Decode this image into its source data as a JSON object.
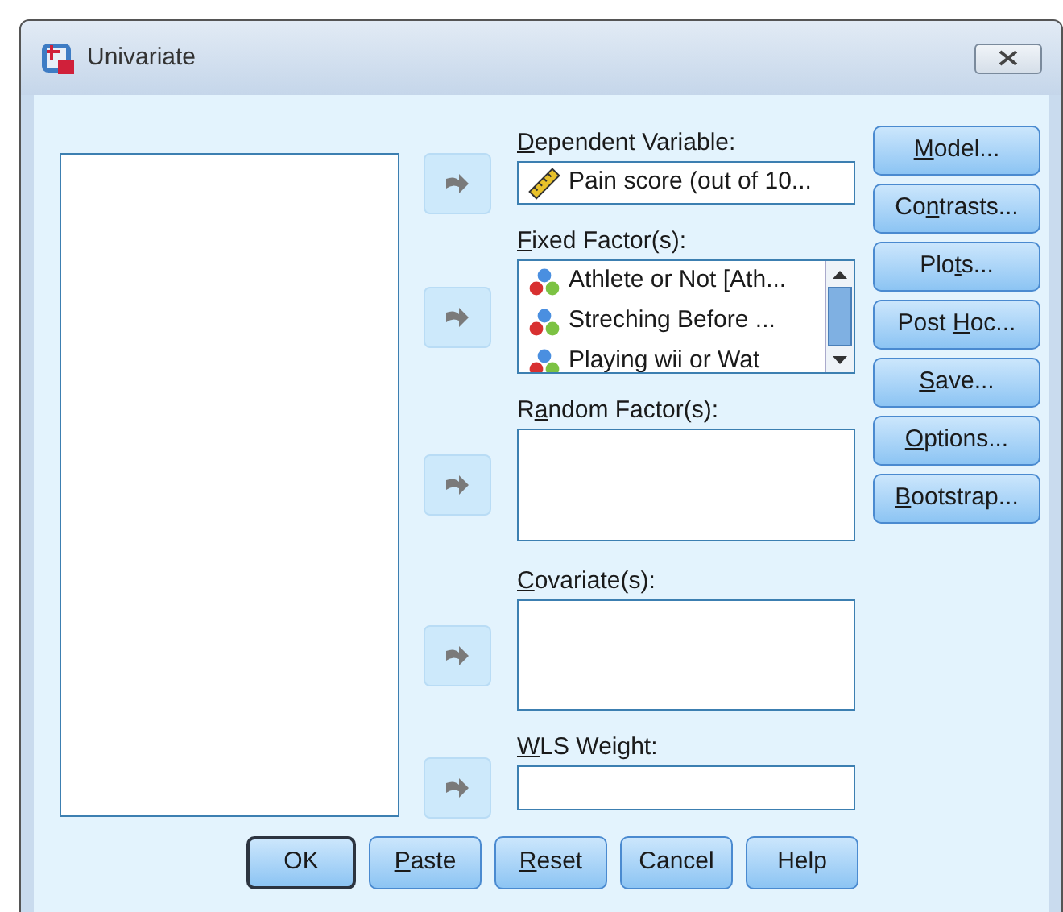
{
  "window": {
    "title": "Univariate"
  },
  "targets": [
    {
      "kind": "single",
      "label": {
        "key": "D",
        "post": "ependent Variable:"
      },
      "items": [
        {
          "kind": "scale",
          "text": "Pain score (out of 10..."
        }
      ]
    },
    {
      "kind": "list",
      "label": {
        "key": "F",
        "post": "ixed Factor(s):"
      },
      "items": [
        {
          "kind": "nominal",
          "text": "Athlete or Not [Ath..."
        },
        {
          "kind": "nominal",
          "text": "Streching Before ..."
        },
        {
          "kind": "nominal",
          "text": "Playing wii or Wat"
        }
      ]
    },
    {
      "kind": "list",
      "label": {
        "pre": "R",
        "key": "a",
        "post": "ndom Factor(s):"
      }
    },
    {
      "kind": "list",
      "label": {
        "key": "C",
        "post": "ovariate(s):"
      }
    },
    {
      "kind": "single",
      "label": {
        "key": "W",
        "post": "LS Weight:"
      }
    }
  ],
  "side_buttons": [
    {
      "key": "M",
      "post": "odel..."
    },
    {
      "pre": "Co",
      "key": "n",
      "post": "trasts..."
    },
    {
      "pre": "Plo",
      "key": "t",
      "post": "s..."
    },
    {
      "pre": "Post ",
      "key": "H",
      "post": "oc..."
    },
    {
      "key": "S",
      "post": "ave..."
    },
    {
      "key": "O",
      "post": "ptions..."
    },
    {
      "key": "B",
      "post": "ootstrap..."
    }
  ],
  "bottom_buttons": [
    {
      "default": true,
      "label": {
        "post": "OK"
      }
    },
    {
      "default": false,
      "label": {
        "key": "P",
        "post": "aste"
      }
    },
    {
      "default": false,
      "label": {
        "key": "R",
        "post": "eset"
      }
    },
    {
      "default": false,
      "label": {
        "post": "Cancel"
      }
    },
    {
      "default": false,
      "label": {
        "post": "Help"
      }
    }
  ]
}
